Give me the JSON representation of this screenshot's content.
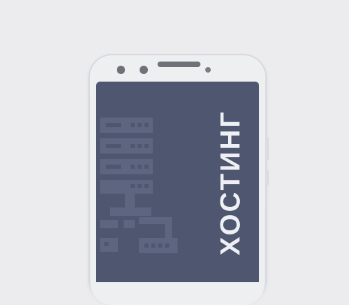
{
  "screen": {
    "title": "ХОСТИНГ"
  },
  "colors": {
    "background": "#ececef",
    "phone_body": "#eeeff1",
    "screen": "#4e5670",
    "pattern": "#5d6580",
    "title": "#eef0f5"
  }
}
